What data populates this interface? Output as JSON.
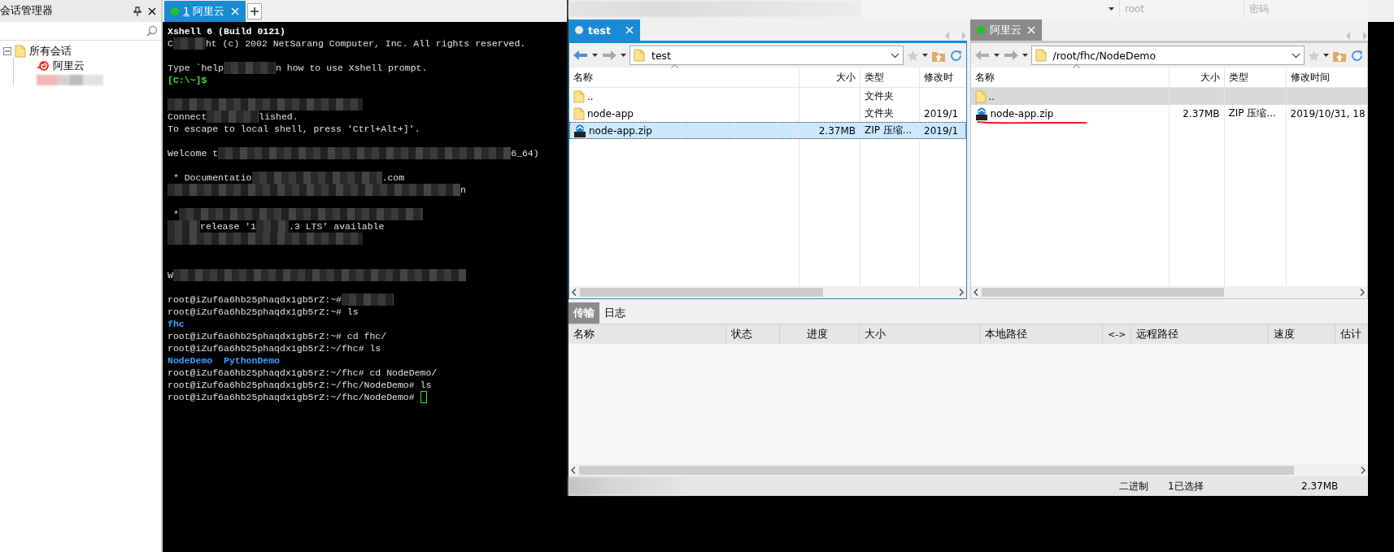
{
  "session_manager": {
    "title": "会话管理器",
    "tree": [
      {
        "kind": "folder",
        "label": "所有会话",
        "expanded": true,
        "children": [
          {
            "kind": "session",
            "label": "阿里云"
          },
          {
            "kind": "redacted"
          }
        ]
      }
    ]
  },
  "terminal": {
    "tabs": [
      {
        "number": "1",
        "label": "阿里云",
        "selected": true,
        "connected": true
      }
    ],
    "lines": [
      {
        "kind": "text",
        "segments": [
          {
            "kind": "heading",
            "text": "Xshell 6 (Build 0121)"
          }
        ]
      },
      {
        "kind": "text",
        "segments": [
          {
            "kind": "text",
            "text": "C"
          },
          {
            "kind": "redacted"
          },
          {
            "kind": "text",
            "text": "ht (c) 2002 NetSarang Computer, Inc. All rights reserved."
          }
        ]
      },
      {
        "kind": "blank"
      },
      {
        "kind": "text",
        "segments": [
          {
            "kind": "text",
            "text": "Type `help"
          },
          {
            "kind": "redacted"
          },
          {
            "kind": "text",
            "text": "n how to use Xshell prompt."
          }
        ]
      },
      {
        "kind": "text",
        "segments": [
          {
            "kind": "prompt",
            "text": "[C:\\~]$"
          }
        ]
      },
      {
        "kind": "blank"
      },
      {
        "kind": "text",
        "segments": [
          {
            "kind": "redacted"
          }
        ]
      },
      {
        "kind": "text",
        "segments": [
          {
            "kind": "text",
            "text": "Connect"
          },
          {
            "kind": "redacted"
          },
          {
            "kind": "text",
            "text": "lished."
          }
        ]
      },
      {
        "kind": "text",
        "segments": [
          {
            "kind": "text",
            "text": "To escape to local shell, press 'Ctrl+Alt+]'."
          }
        ]
      },
      {
        "kind": "blank"
      },
      {
        "kind": "text",
        "segments": [
          {
            "kind": "text",
            "text": "Welcome t"
          },
          {
            "kind": "redacted"
          },
          {
            "kind": "text",
            "text": "6_64)"
          }
        ]
      },
      {
        "kind": "blank"
      },
      {
        "kind": "text",
        "segments": [
          {
            "kind": "text",
            "text": " * Documentatio"
          },
          {
            "kind": "redacted"
          },
          {
            "kind": "text",
            "text": ".com"
          }
        ]
      },
      {
        "kind": "text",
        "segments": [
          {
            "kind": "redacted"
          },
          {
            "kind": "text",
            "text": "n"
          }
        ]
      },
      {
        "kind": "blank"
      },
      {
        "kind": "text",
        "segments": [
          {
            "kind": "text",
            "text": " *"
          },
          {
            "kind": "redacted"
          }
        ]
      },
      {
        "kind": "text",
        "segments": [
          {
            "kind": "redacted"
          },
          {
            "kind": "text",
            "text": "release '1"
          },
          {
            "kind": "redacted"
          },
          {
            "kind": "text",
            "text": ".3 LTS' available"
          }
        ]
      },
      {
        "kind": "text",
        "segments": [
          {
            "kind": "redacted"
          }
        ]
      },
      {
        "kind": "blank"
      },
      {
        "kind": "blank"
      },
      {
        "kind": "text",
        "segments": [
          {
            "kind": "text",
            "text": "W"
          },
          {
            "kind": "redacted"
          }
        ]
      },
      {
        "kind": "blank"
      },
      {
        "kind": "text",
        "segments": [
          {
            "kind": "text",
            "text": "root@iZuf6a6hb25phaqdx1gb5rZ:~#"
          },
          {
            "kind": "redacted"
          }
        ]
      },
      {
        "kind": "text",
        "segments": [
          {
            "kind": "text",
            "text": "root@iZuf6a6hb25phaqdx1gb5rZ:~# ls"
          }
        ]
      },
      {
        "kind": "text",
        "segments": [
          {
            "kind": "directory",
            "text": "fhc"
          }
        ]
      },
      {
        "kind": "text",
        "segments": [
          {
            "kind": "text",
            "text": "root@iZuf6a6hb25phaqdx1gb5rZ:~# cd fhc/"
          }
        ]
      },
      {
        "kind": "text",
        "segments": [
          {
            "kind": "text",
            "text": "root@iZuf6a6hb25phaqdx1gb5rZ:~/fhc# ls"
          }
        ]
      },
      {
        "kind": "text",
        "segments": [
          {
            "kind": "directory",
            "text": "NodeDemo  PythonDemo"
          }
        ]
      },
      {
        "kind": "text",
        "segments": [
          {
            "kind": "text",
            "text": "root@iZuf6a6hb25phaqdx1gb5rZ:~/fhc# cd NodeDemo/"
          }
        ]
      },
      {
        "kind": "text",
        "segments": [
          {
            "kind": "text",
            "text": "root@iZuf6a6hb25phaqdx1gb5rZ:~/fhc/NodeDemo# ls"
          }
        ]
      },
      {
        "kind": "text",
        "segments": [
          {
            "kind": "text",
            "text": "root@iZuf6a6hb25phaqdx1gb5rZ:~/fhc/NodeDemo# "
          },
          {
            "kind": "cursor"
          }
        ]
      }
    ]
  },
  "xftp": {
    "login_fields": [
      {
        "placeholder": "root"
      },
      {
        "placeholder": "密码"
      }
    ],
    "panes": [
      {
        "tab": {
          "label": "test",
          "selected": true,
          "connected": false
        },
        "can_go_back": true,
        "path": "test",
        "columns": [
          "名称",
          "大小",
          "类型",
          "修改时"
        ],
        "rows": [
          {
            "kind": "folder",
            "name": "..",
            "type": "文件夹",
            "selected": false,
            "annotated": false
          },
          {
            "kind": "folder",
            "name": "node-app",
            "type": "文件夹",
            "modified": "2019/1",
            "selected": false,
            "annotated": false
          },
          {
            "kind": "zip",
            "name": "node-app.zip",
            "size": "2.37MB",
            "type": "ZIP 压缩...",
            "modified": "2019/1",
            "selected": true,
            "annotated": false
          }
        ]
      },
      {
        "tab": {
          "label": "阿里云",
          "selected": false,
          "connected": true
        },
        "can_go_back": false,
        "path": "/root/fhc/NodeDemo",
        "columns": [
          "名称",
          "大小",
          "类型",
          "修改时间"
        ],
        "rows": [
          {
            "kind": "folder",
            "name": "..",
            "selected": true,
            "annotated": false
          },
          {
            "kind": "zip",
            "name": "node-app.zip",
            "size": "2.37MB",
            "type": "ZIP 压缩...",
            "modified": "2019/10/31, 18",
            "selected": false,
            "annotated": true
          }
        ]
      }
    ],
    "bottom_tabs": [
      {
        "label": "传输",
        "selected": true
      },
      {
        "label": "日志",
        "selected": false
      }
    ],
    "transfer_columns": [
      "名称",
      "状态",
      "进度",
      "大小",
      "本地路径",
      "<->",
      "远程路径",
      "速度",
      "估计"
    ],
    "status_bar": {
      "mode": "二进制",
      "selection": "1已选择",
      "total_size": "2.37MB"
    }
  }
}
